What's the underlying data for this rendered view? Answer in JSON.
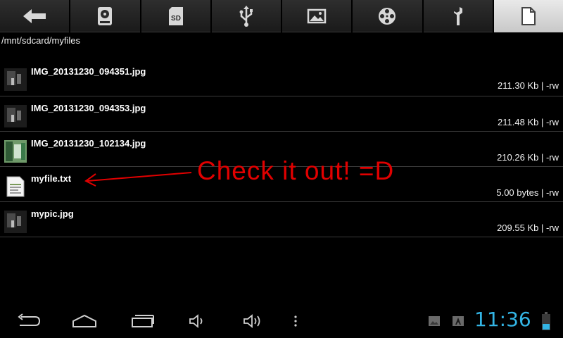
{
  "toolbar": {
    "tabs": [
      {
        "icon": "back-arrow-icon",
        "active": false
      },
      {
        "icon": "disk-drive-icon",
        "active": false
      },
      {
        "icon": "sd-card-icon",
        "active": false
      },
      {
        "icon": "usb-icon",
        "active": false
      },
      {
        "icon": "image-icon",
        "active": false
      },
      {
        "icon": "film-reel-icon",
        "active": false
      },
      {
        "icon": "wrench-icon",
        "active": false
      },
      {
        "icon": "document-icon",
        "active": true
      }
    ],
    "sd_label": "SD"
  },
  "path": "/mnt/sdcard/myfiles",
  "files": [
    {
      "name": "IMG_20131230_094351.jpg",
      "meta": "211.30 Kb  | -rw",
      "thumb": "dark-photo"
    },
    {
      "name": "IMG_20131230_094353.jpg",
      "meta": "211.48 Kb  | -rw",
      "thumb": "dark-photo"
    },
    {
      "name": "IMG_20131230_102134.jpg",
      "meta": "210.26 Kb  | -rw",
      "thumb": "green-photo"
    },
    {
      "name": "myfile.txt",
      "meta": "5.00 bytes  | -rw",
      "thumb": "text-file"
    },
    {
      "name": "mypic.jpg",
      "meta": "209.55 Kb  | -rw",
      "thumb": "dark-photo"
    }
  ],
  "annotation": {
    "text": "Check it out! =D",
    "color": "#e10000"
  },
  "system_bar": {
    "time": "11:36",
    "clock_color": "#33b5e5",
    "buttons": [
      "back-icon",
      "home-icon",
      "recent-apps-icon",
      "volume-down-icon",
      "volume-up-icon",
      "menu-dots-icon"
    ],
    "notifications": [
      "gallery-notification-icon",
      "keyboard-notification-icon",
      "battery-icon"
    ]
  }
}
